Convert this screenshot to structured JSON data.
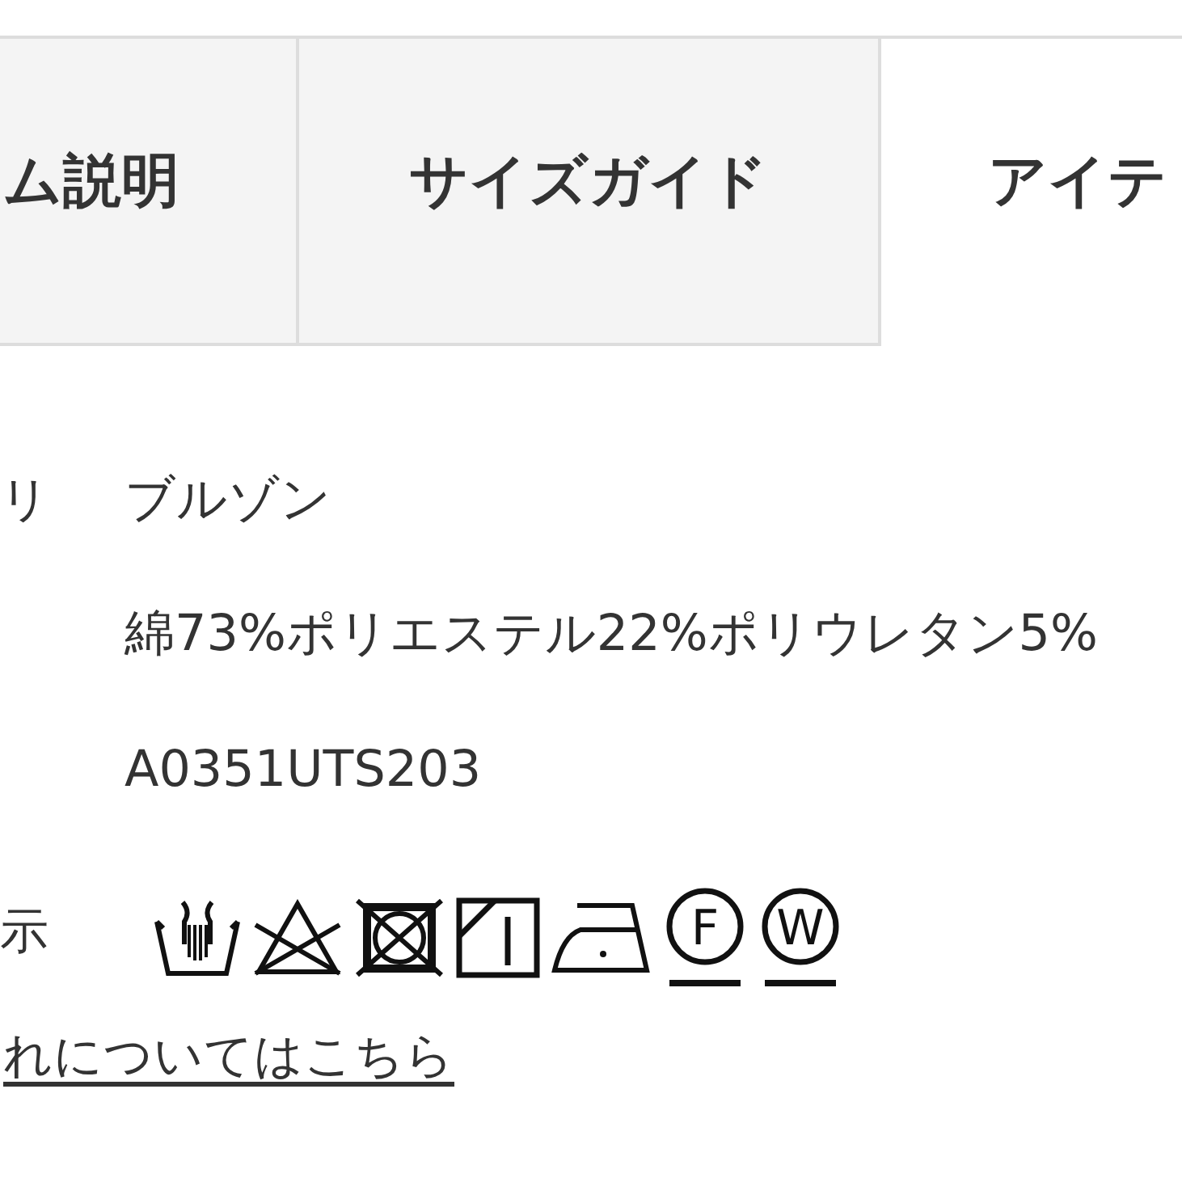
{
  "tabs": [
    {
      "label": "ム説明",
      "selected": false
    },
    {
      "label": "サイズガイド",
      "selected": false
    },
    {
      "label": "アイテ",
      "selected": true
    }
  ],
  "details": [
    {
      "label": "リ",
      "value": "ブルゾン"
    },
    {
      "value": "綿73%ポリエステル22%ポリウレタン5%"
    },
    {
      "value": "A0351UTS203"
    },
    {
      "label": "示",
      "care_symbols": [
        {
          "kind": "hand_wash"
        },
        {
          "kind": "no_bleach"
        },
        {
          "kind": "no_tumble_dry"
        },
        {
          "kind": "shade_line_dry"
        },
        {
          "kind": "iron"
        },
        {
          "kind": "dry_clean",
          "letter": "F"
        },
        {
          "kind": "wet_clean",
          "letter": "W"
        }
      ]
    }
  ],
  "link": "れについてはこちら"
}
